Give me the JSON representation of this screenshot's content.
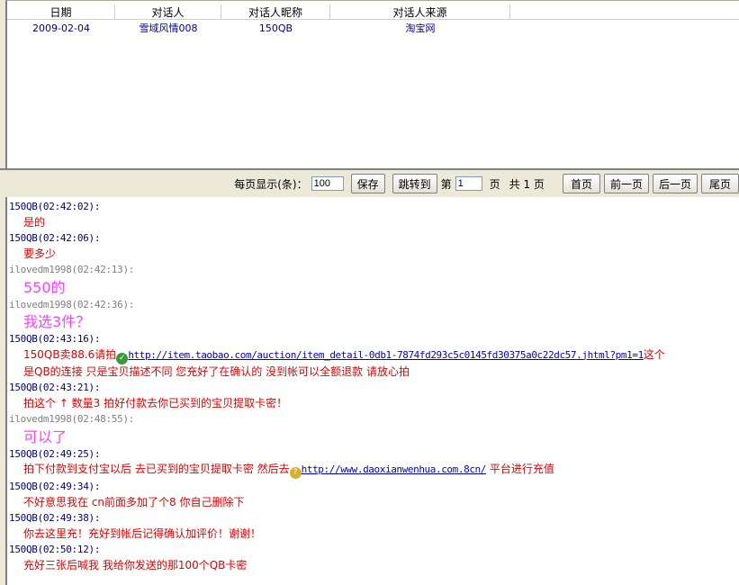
{
  "grid": {
    "headers": [
      "日期",
      "对话人",
      "对话人昵称",
      "对话人来源"
    ],
    "rows": [
      [
        "2009-02-04",
        "雪域风情008",
        "150QB",
        "淘宝网"
      ]
    ]
  },
  "pager": {
    "per_page_label": "每页显示(条)：",
    "per_page_value": "100",
    "save": "保存",
    "jump": "跳转到",
    "page_prefix": "第",
    "page_value": "1",
    "page_suffix": "页",
    "total": "共 1 页",
    "first": "首页",
    "prev": "前一页",
    "next": "后一页",
    "last": "尾页"
  },
  "colors": {
    "seller": "#000080",
    "buyer": "#808080",
    "seller_text": "#e00000",
    "buyer_text": "#ff40ff"
  },
  "messages": [
    {
      "head": "150QB(02:42:02):",
      "role": "seller",
      "text": "是的"
    },
    {
      "head": "150QB(02:42:06):",
      "role": "seller",
      "text": "要多少"
    },
    {
      "head": "ilovedm1998(02:42:13):",
      "role": "buyer",
      "text": "550的"
    },
    {
      "head": "ilovedm1998(02:42:36):",
      "role": "buyer",
      "text": "我选3件？"
    },
    {
      "head": "150QB(02:43:16):",
      "role": "seller",
      "text": "150QB卖88.6请拍",
      "icon": "check-shield-icon",
      "link": "http://item.taobao.com/auction/item_detail-0db1-7874fd293c5c0145fd30375a0c22dc57.jhtml?pm1=1",
      "after": "这个",
      "text2": "是QB的连接 只是宝贝描述不同 您充好了在确认的 没到帐可以全额退款 请放心拍"
    },
    {
      "head": "150QB(02:43:21):",
      "role": "seller",
      "text": "拍这个 ↑ 数量3 拍好付款去你已买到的宝贝提取卡密！"
    },
    {
      "head": "ilovedm1998(02:48:55):",
      "role": "buyer",
      "text": "可以了"
    },
    {
      "head": "150QB(02:49:25):",
      "role": "seller",
      "text": "拍下付款到支付宝以后 去已买到的宝贝提取卡密 然后去",
      "icon": "warning-shield-icon",
      "link": "http://www.daoxianwenhua.com.8cn/",
      "after": " 平台进行充值"
    },
    {
      "head": "150QB(02:49:34):",
      "role": "seller",
      "text": "不好意思我在 cn前面多加了个8  你自己删除下"
    },
    {
      "head": "150QB(02:49:38):",
      "role": "seller",
      "text": "你去这里充！充好到帐后记得确认加评价！谢谢！"
    },
    {
      "head": "150QB(02:50:12):",
      "role": "seller",
      "text": "充好三张后喊我  我给你发送的那100个QB卡密"
    }
  ]
}
